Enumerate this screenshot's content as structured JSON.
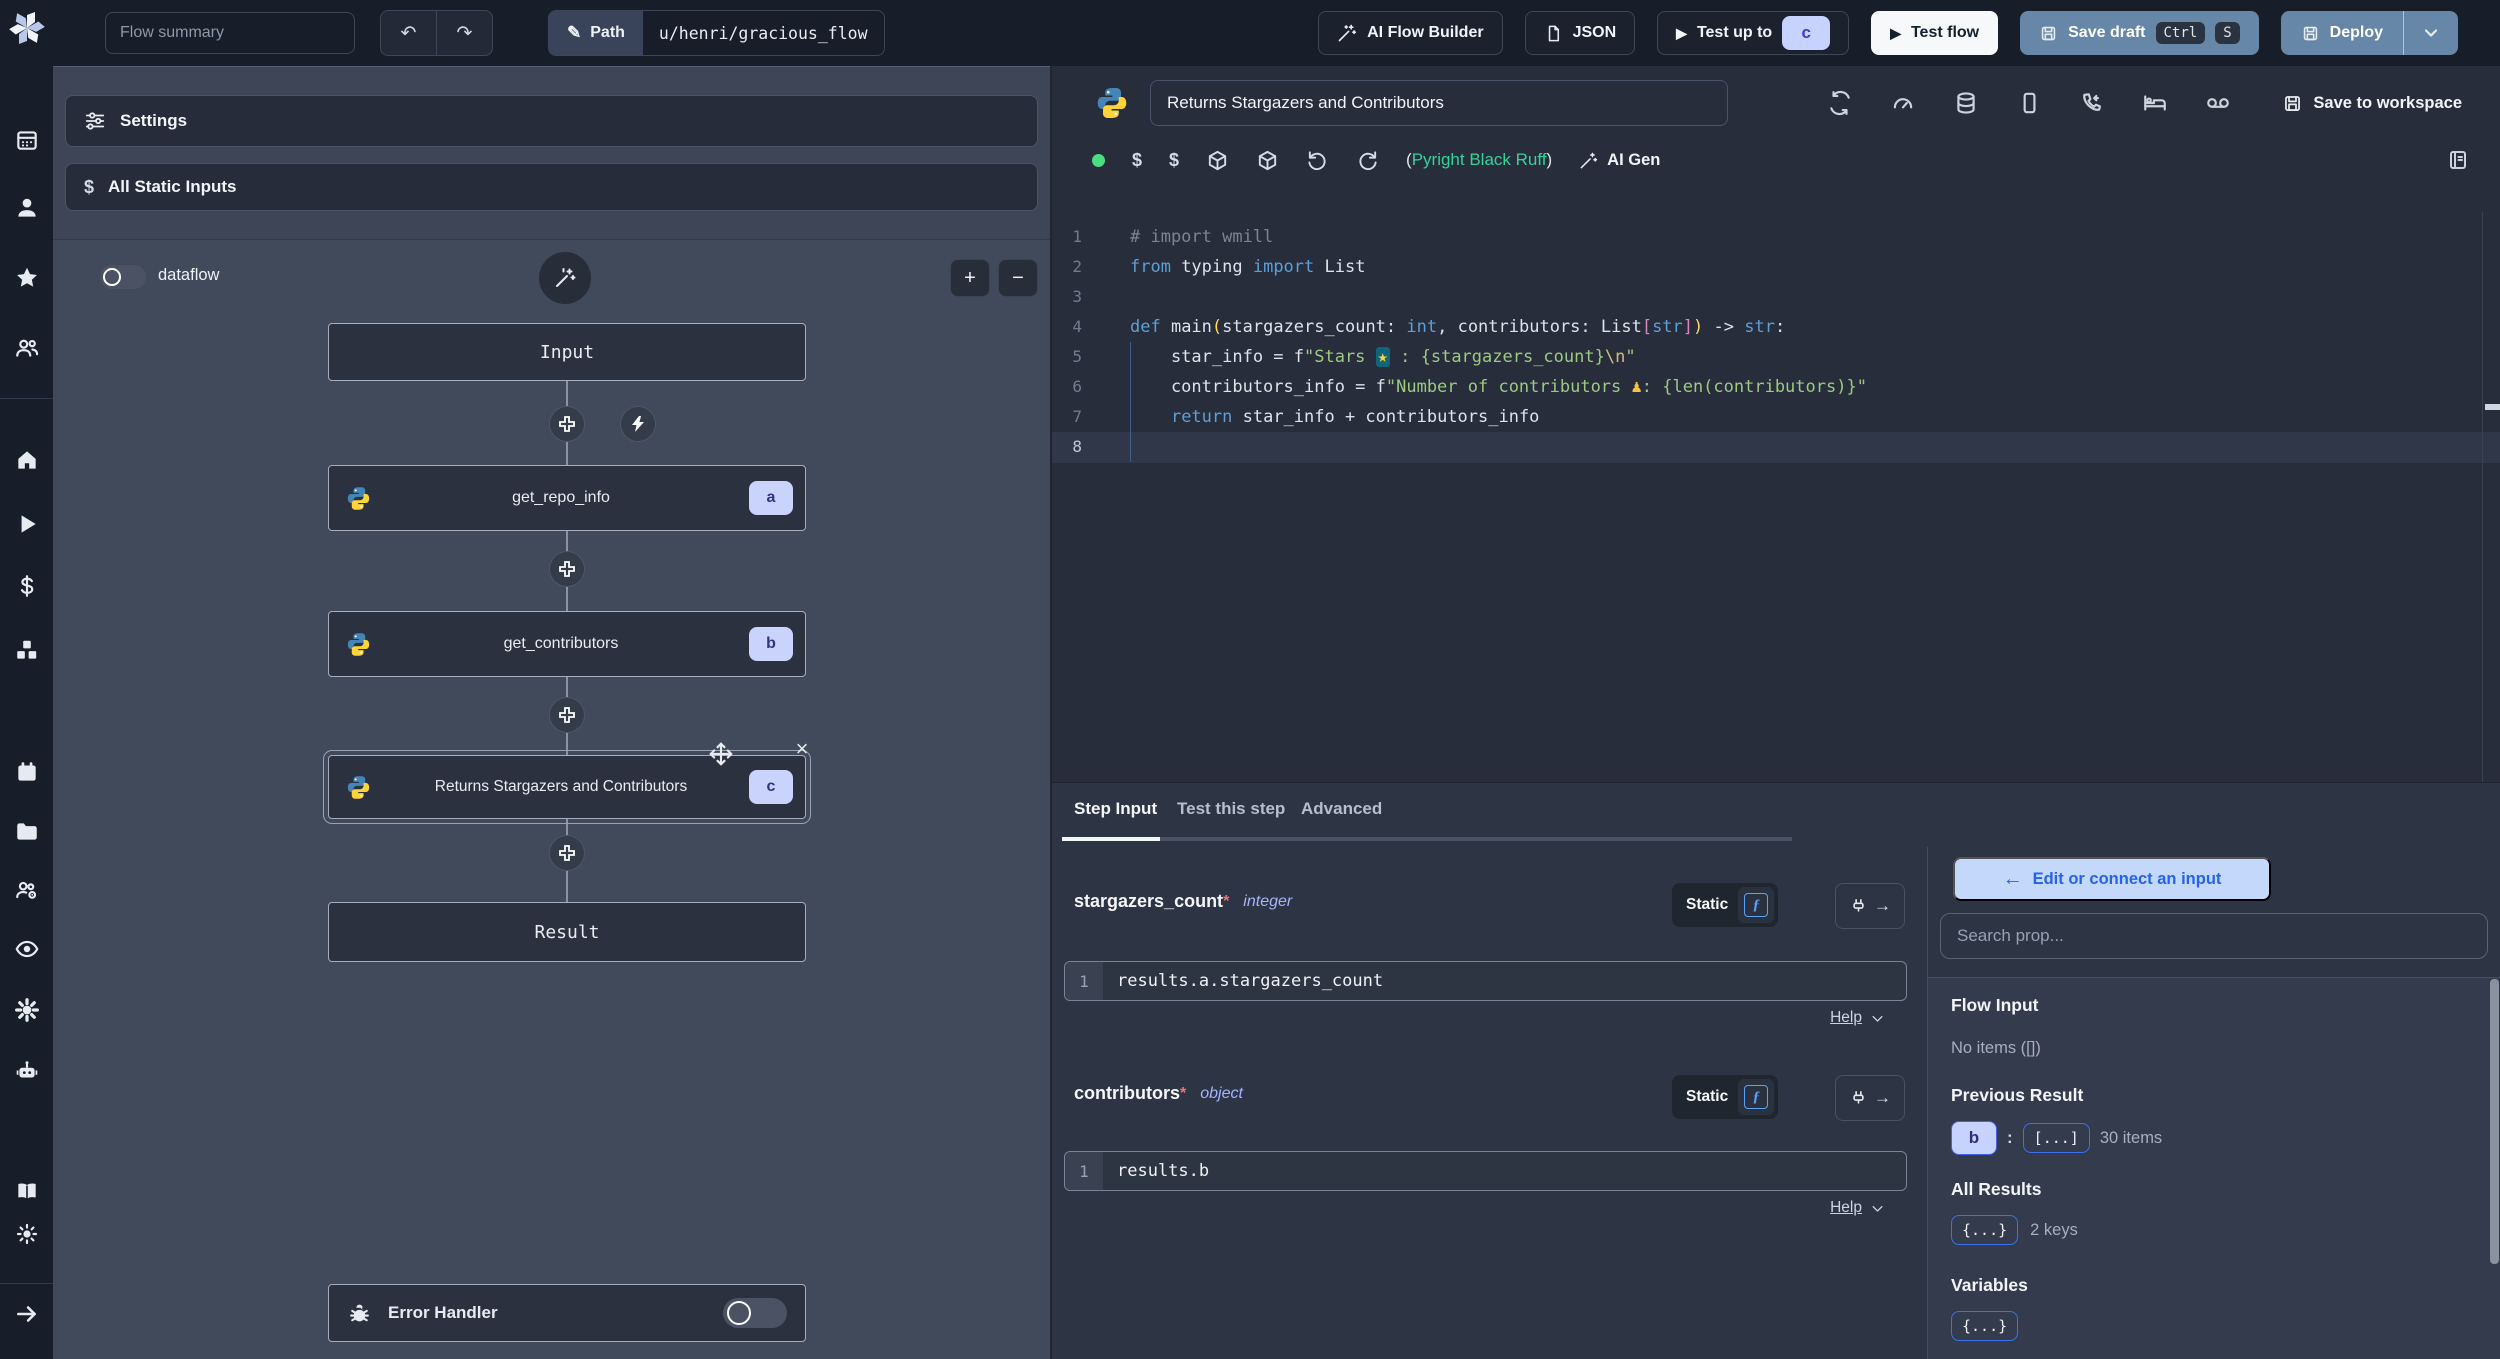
{
  "glyphs": {
    "plus": "+",
    "minus": "−",
    "close": "×",
    "colon": ":",
    "dollar": "$",
    "undo": "↶",
    "redo": "↷",
    "pencil": "✎",
    "play": "▶",
    "back_arrow": "←",
    "arrow_right": "→",
    "f_italic": "ƒ",
    "green_dot": "●"
  },
  "topbar": {
    "flow_summary_placeholder": "Flow summary",
    "path_label": "Path",
    "path_value": "u/henri/gracious_flow",
    "ai_flow_builder": "AI Flow Builder",
    "json": "JSON",
    "test_up_to": "Test up to",
    "test_up_to_badge": "c",
    "test_flow": "Test flow",
    "save_draft": "Save draft",
    "kbd_ctrl": "Ctrl",
    "kbd_s": "S",
    "deploy": "Deploy"
  },
  "sidebar": {
    "icons": [
      "windmill-logo",
      "apps",
      "user",
      "favorites",
      "user-groups",
      "home",
      "runs",
      "variables",
      "resources",
      "schedules",
      "folders",
      "workers",
      "audit-logs",
      "settings",
      "ai-assistant",
      "docs",
      "theme-toggle",
      "expand-sidebar"
    ]
  },
  "flow_panel": {
    "settings": "Settings",
    "all_static_inputs": "All Static Inputs",
    "dataflow": "dataflow",
    "input_node": "Input",
    "result_node": "Result",
    "error_handler": "Error Handler",
    "steps": [
      {
        "label": "get_repo_info",
        "badge": "a"
      },
      {
        "label": "get_contributors",
        "badge": "b"
      },
      {
        "label": "Returns Stargazers and Contributors",
        "badge": "c"
      }
    ]
  },
  "editor": {
    "title": "Returns Stargazers and Contributors",
    "save_to_workspace": "Save to workspace",
    "lint_open": "(",
    "lint_text": "Pyright Black Ruff",
    "lint_close": ")",
    "ai_gen": "AI Gen",
    "code_lines": [
      [
        {
          "t": "# import wmill",
          "c": "cm"
        }
      ],
      [
        {
          "t": "from",
          "c": "kw"
        },
        {
          "t": " typing ",
          "c": "pl"
        },
        {
          "t": "import",
          "c": "kw"
        },
        {
          "t": " List",
          "c": "pl"
        }
      ],
      [],
      [
        {
          "t": "def",
          "c": "kw"
        },
        {
          "t": " main",
          "c": "pl"
        },
        {
          "t": "(",
          "c": "b1"
        },
        {
          "t": "stargazers_count: ",
          "c": "pl"
        },
        {
          "t": "int",
          "c": "ty"
        },
        {
          "t": ", contributors: List",
          "c": "pl"
        },
        {
          "t": "[",
          "c": "b2"
        },
        {
          "t": "str",
          "c": "ty"
        },
        {
          "t": "]",
          "c": "b2"
        },
        {
          "t": ")",
          "c": "b1"
        },
        {
          "t": " -> ",
          "c": "pl"
        },
        {
          "t": "str",
          "c": "ty"
        },
        {
          "t": ":",
          "c": "pl"
        }
      ],
      [
        {
          "t": "    star_info = f",
          "c": "pl"
        },
        {
          "t": "\"Stars ",
          "c": "st"
        },
        {
          "t": "★",
          "c": "es"
        },
        {
          "t": " : {stargazers_count}",
          "c": "st"
        },
        {
          "t": "\\n",
          "c": "e2"
        },
        {
          "t": "\"",
          "c": "st"
        }
      ],
      [
        {
          "t": "    contributors_info = f",
          "c": "pl"
        },
        {
          "t": "\"Number of contributors ",
          "c": "st"
        },
        {
          "t": "♟",
          "c": "ew"
        },
        {
          "t": ": {len(contributors)}",
          "c": "st"
        },
        {
          "t": "\"",
          "c": "st"
        }
      ],
      [
        {
          "t": "    ",
          "c": "pl"
        },
        {
          "t": "return",
          "c": "kw"
        },
        {
          "t": " star_info + contributors_info",
          "c": "pl"
        }
      ],
      []
    ]
  },
  "step_panel": {
    "tabs": [
      "Step Input",
      "Test this step",
      "Advanced"
    ],
    "fields": [
      {
        "name": "stargazers_count",
        "required": "*",
        "type": "integer",
        "mode": "Static",
        "line": "1",
        "value": "results.a.stargazers_count",
        "help": "Help"
      },
      {
        "name": "contributors",
        "required": "*",
        "type": "object",
        "mode": "Static",
        "line": "1",
        "value": "results.b",
        "help": "Help"
      }
    ]
  },
  "connections": {
    "edit_button": "Edit or connect an input",
    "search_placeholder": "Search prop...",
    "flow_input_title": "Flow Input",
    "flow_input_empty": "No items ([])",
    "previous_result_title": "Previous Result",
    "previous_result_badge": "b",
    "previous_result_collapsed": "[...]",
    "previous_result_count": "30 items",
    "all_results_title": "All Results",
    "all_results_collapsed": "{...}",
    "all_results_count": "2 keys",
    "variables_title": "Variables",
    "variables_collapsed": "{...}"
  }
}
